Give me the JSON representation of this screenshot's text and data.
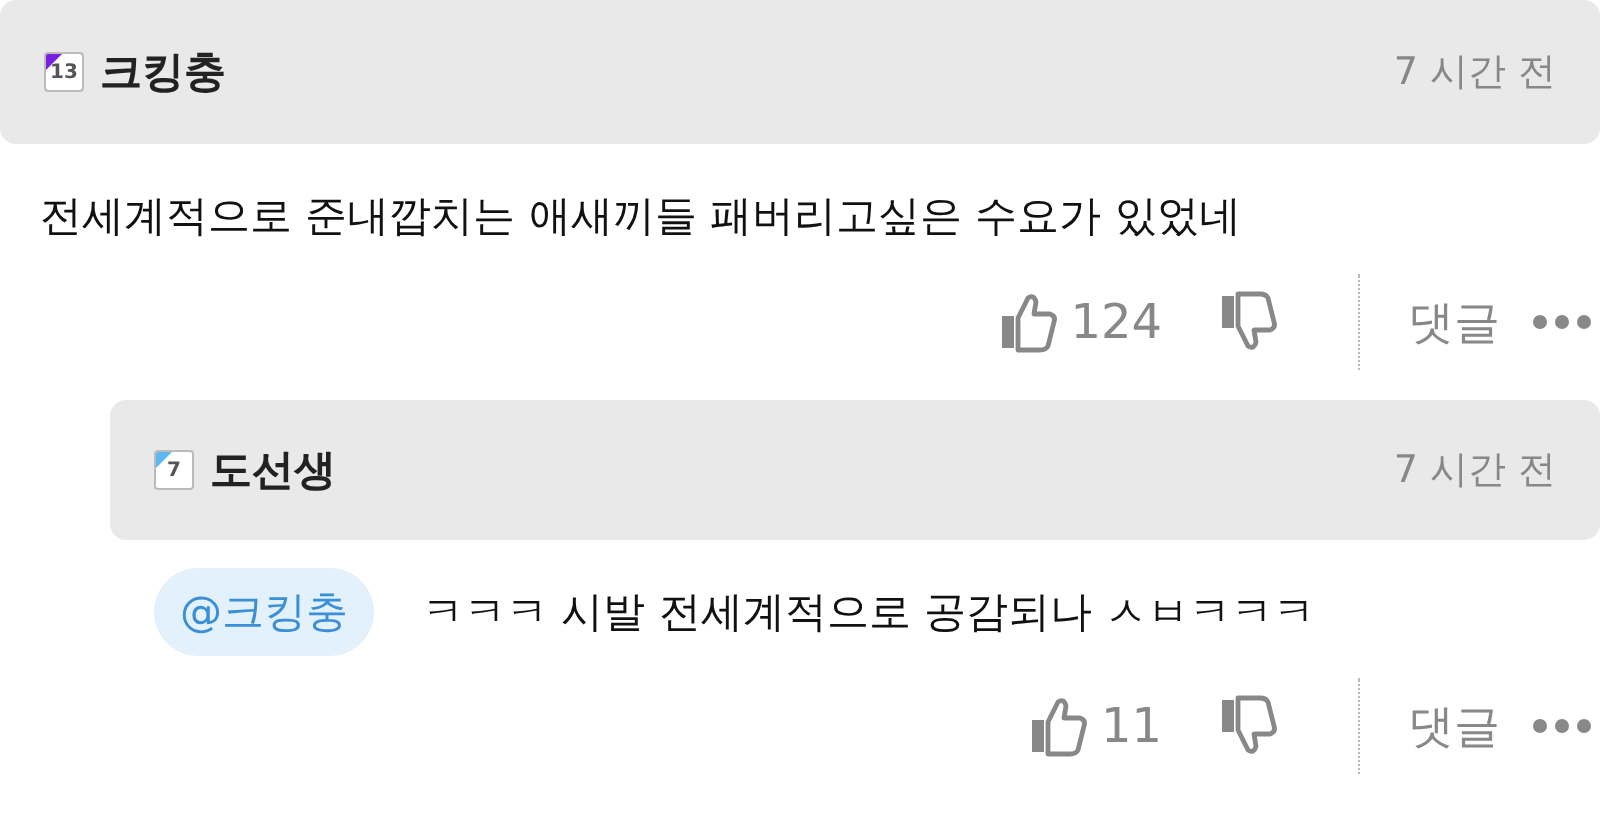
{
  "comments": [
    {
      "level_badge": {
        "text": "13",
        "color": "#7a1fe0"
      },
      "author": "크킹충",
      "time": "7 시간 전",
      "body": "전세계적으로 준내깝치는 애새끼들 패버리고싶은 수요가 있었네",
      "likes": "124",
      "reply_label": "댓글",
      "is_reply": false
    },
    {
      "level_badge": {
        "text": "7",
        "color": "#5cb8f0"
      },
      "author": "도선생",
      "time": "7 시간 전",
      "mention": "@크킹충",
      "body": "ㅋㅋㅋ 시발 전세계적으로 공감되나 ㅅㅂㅋㅋㅋ",
      "likes": "11",
      "reply_label": "댓글",
      "is_reply": true
    }
  ]
}
